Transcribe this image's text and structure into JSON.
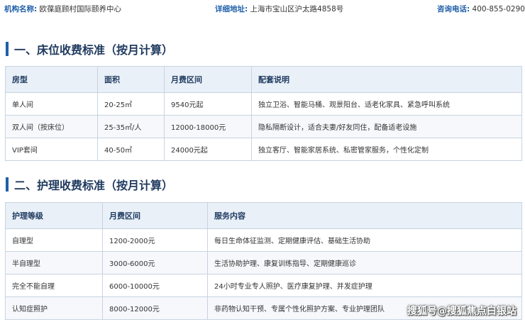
{
  "header": {
    "org_label": "机构名称:",
    "org_value": "欧葆庭顾村国际颐养中心",
    "addr_label": "详细地址:",
    "addr_value": "上海市宝山区沪太路4858号",
    "phone_label": "咨询电话:",
    "phone_value": "400-855-0290"
  },
  "bed_section": {
    "title": "一、床位收费标准（按月计算）",
    "columns": [
      "房型",
      "面积",
      "月费区间",
      "配套说明"
    ],
    "rows": [
      [
        "单人间",
        "20-25㎡",
        "9540元起",
        "独立卫浴、智能马桶、观景阳台、适老化家具、紧急呼叫系统"
      ],
      [
        "双人间（按床位）",
        "25-35㎡/人",
        "12000-18000元",
        "隐私隔断设计，适合夫妻/好友同住，配备适老设施"
      ],
      [
        "VIP套间",
        "40-50㎡",
        "24000元起",
        "独立客厅、智能家居系统、私密管家服务，个性化定制"
      ]
    ]
  },
  "care_section": {
    "title": "二、护理收费标准（按月计算）",
    "columns": [
      "护理等级",
      "月费区间",
      "服务内容"
    ],
    "rows": [
      [
        "自理型",
        "1200-2000元",
        "每日生命体征监测、定期健康评估、基础生活协助"
      ],
      [
        "半自理型",
        "3000-6000元",
        "生活协助护理、康复训练指导、定期健康巡诊"
      ],
      [
        "完全不能自理",
        "6000-10000元",
        "24小时专业专人照护、医疗康复护理、并发症护理"
      ],
      [
        "认知症照护",
        "8000-12000元",
        "非药物认知干预、专属个性化照护方案、专业护理团队"
      ]
    ]
  },
  "watermark": "搜狐号@搜狐焦点白银站"
}
